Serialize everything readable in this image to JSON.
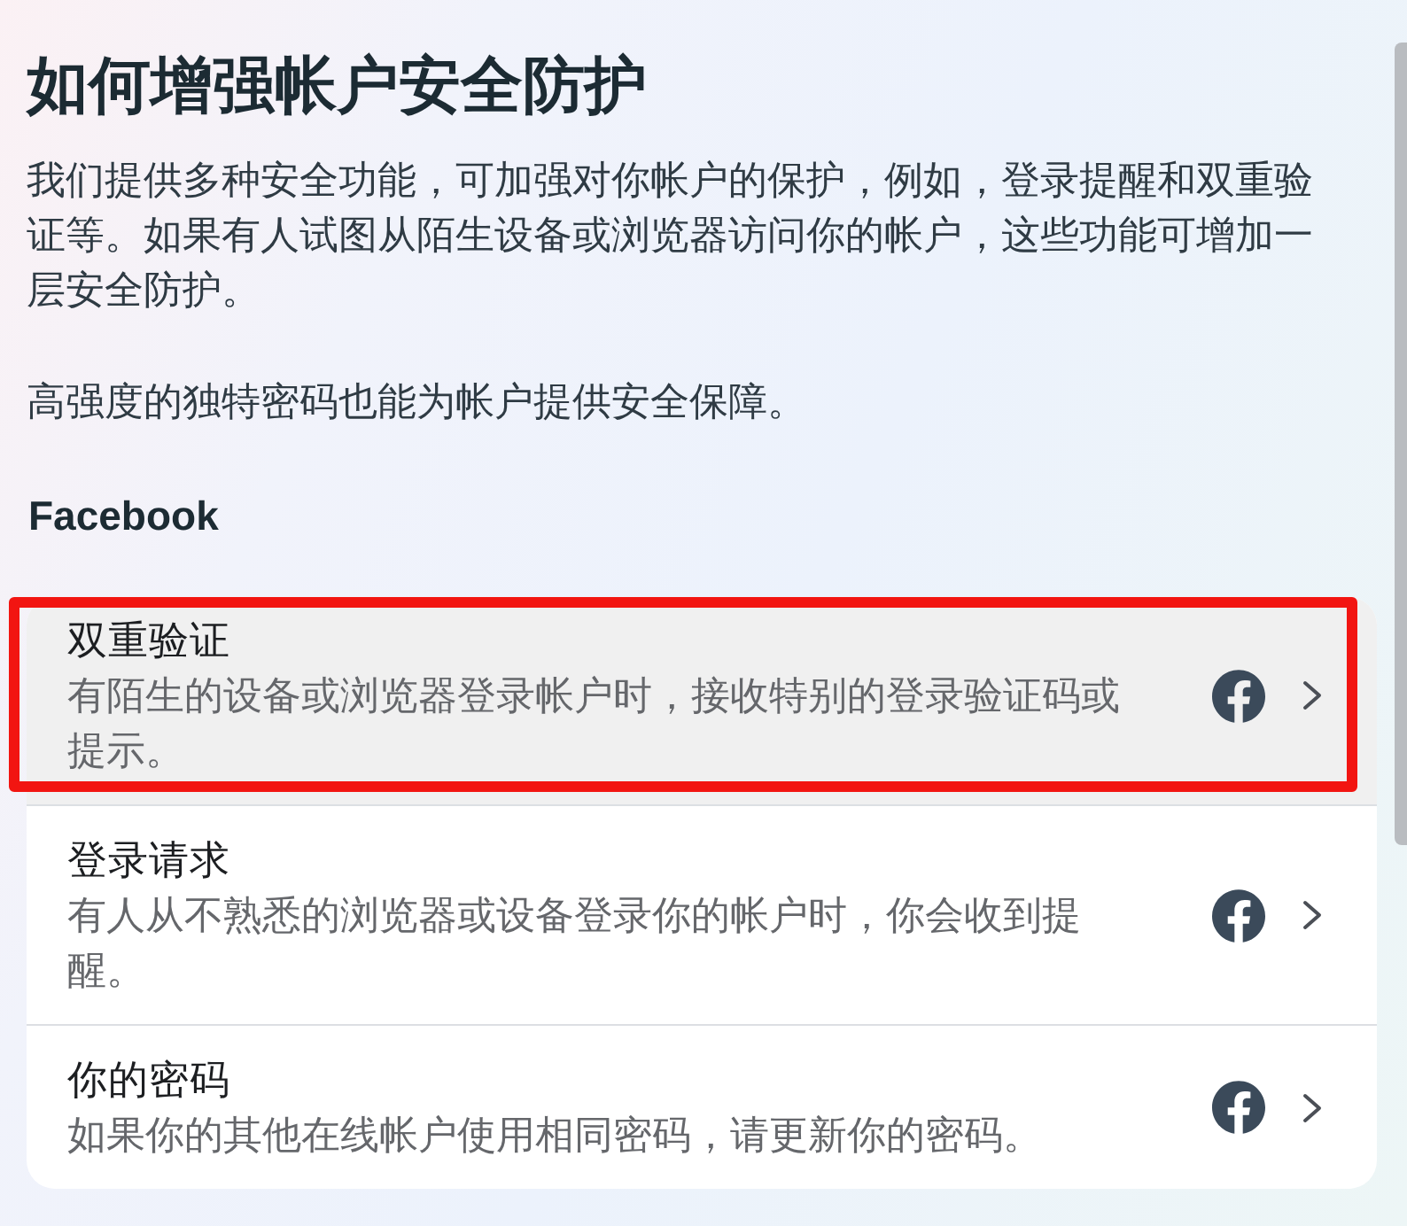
{
  "title": "如何增强帐户安全防护",
  "paragraphs": [
    "我们提供多种安全功能，可加强对你帐户的保护，例如，登录提醒和双重验证等。如果有人试图从陌生设备或浏览器访问你的帐户，这些功能可增加一层安全防护。",
    "高强度的独特密码也能为帐户提供安全保障。"
  ],
  "section_heading": "Facebook",
  "security_items": [
    {
      "title": "双重验证",
      "description": "有陌生的设备或浏览器登录帐户时，接收特别的登录验证码或提示。",
      "selected": true,
      "highlighted": true
    },
    {
      "title": "登录请求",
      "description": "有人从不熟悉的浏览器或设备登录你的帐户时，你会收到提醒。",
      "selected": false,
      "highlighted": false
    },
    {
      "title": "你的密码",
      "description": "如果你的其他在线帐户使用相同密码，请更新你的密码。",
      "selected": false,
      "highlighted": false
    }
  ]
}
